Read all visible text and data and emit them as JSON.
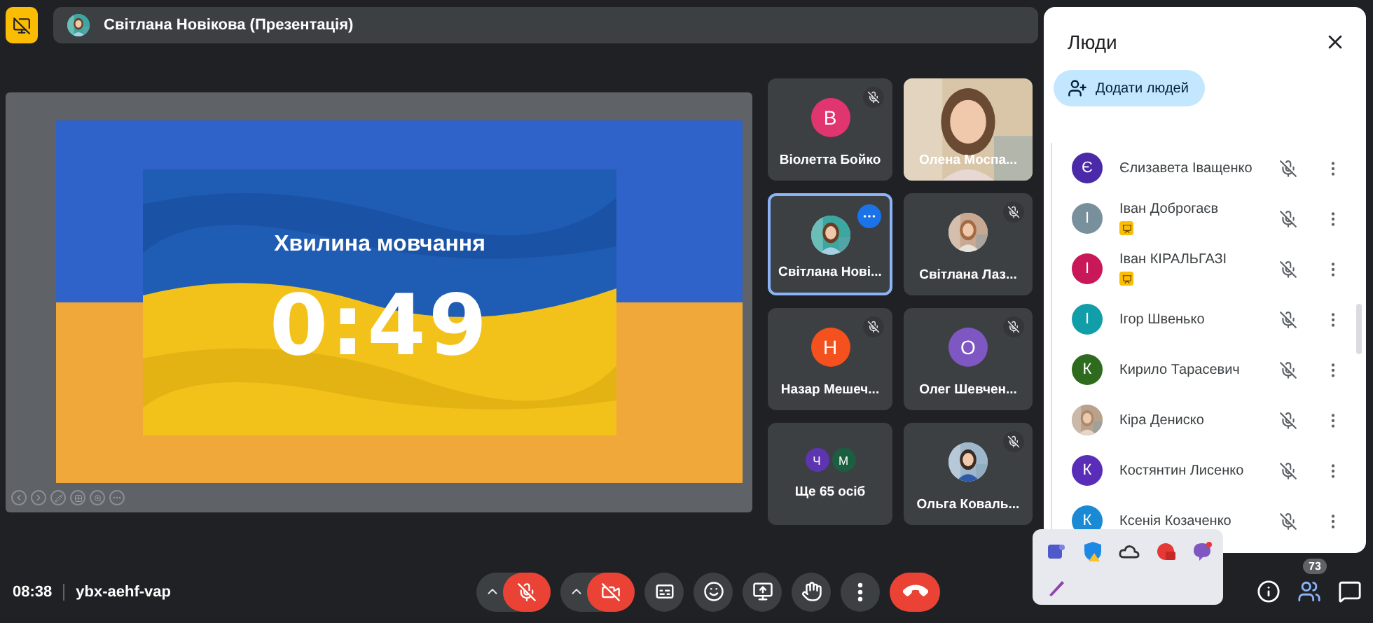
{
  "top_bar": {
    "presenter": "Світлана Новікова (Презентація)"
  },
  "slide": {
    "title": "Хвилина мовчання",
    "timer": "0:49"
  },
  "tiles": [
    {
      "kind": "initial",
      "name": "Віолетта Бойко",
      "initial": "В",
      "color": "#e0356f",
      "muted": true,
      "selected": false
    },
    {
      "kind": "video",
      "name": "Олена Моспа...",
      "muted": false,
      "selected": false
    },
    {
      "name": "Світлана Нові...",
      "muted": false,
      "selected": true
    },
    {
      "name": "Світлана Лаз...",
      "muted": true,
      "selected": false
    },
    {
      "kind": "initial",
      "name": "Назар Мешеч...",
      "initial": "Н",
      "color": "#f4511e",
      "muted": true,
      "selected": false
    },
    {
      "kind": "initial",
      "name": "Олег Шевчен...",
      "initial": "О",
      "color": "#7e57c2",
      "muted": true,
      "selected": false
    },
    {
      "kind": "more",
      "name": "Ще 65 осіб",
      "initials": [
        {
          "letter": "Ч",
          "color": "#5e35b1"
        },
        {
          "letter": "М",
          "color": "#1b5e40"
        }
      ],
      "muted": false,
      "selected": false
    },
    {
      "name": "Ольга Коваль...",
      "muted": true,
      "selected": false
    }
  ],
  "people_panel": {
    "title": "Люди",
    "add_button": "Додати людей",
    "people": [
      {
        "kind": "initial",
        "name": "Єлизавета Іващенко",
        "initial": "Є",
        "color": "#4a2aa8",
        "presenting": false,
        "muted": true
      },
      {
        "kind": "initial",
        "name": "Іван Доброгаєв",
        "initial": "І",
        "color": "#78909c",
        "presenting": true,
        "muted": true
      },
      {
        "kind": "initial",
        "name": "Іван КІРАЛЬГАЗІ",
        "initial": "І",
        "color": "#c8185a",
        "presenting": true,
        "muted": true
      },
      {
        "kind": "initial",
        "name": "Ігор Швенько",
        "initial": "І",
        "color": "#129ea8",
        "presenting": false,
        "muted": true
      },
      {
        "kind": "initial",
        "name": "Кирило Тарасевич",
        "initial": "К",
        "color": "#2e6b1e",
        "presenting": false,
        "muted": true
      },
      {
        "name": "Кіра Дениско",
        "presenting": false,
        "muted": true
      },
      {
        "kind": "initial",
        "name": "Костянтин Лисенко",
        "initial": "К",
        "color": "#5a2db8",
        "presenting": false,
        "muted": true
      },
      {
        "kind": "initial",
        "name": "Ксенія Козаченко",
        "initial": "К",
        "color": "#1a8ad4",
        "presenting": false,
        "muted": true
      }
    ]
  },
  "meeting": {
    "time": "08:38",
    "code": "ybx-aehf-vap"
  },
  "controls": [
    {
      "kind": "mic",
      "on": false
    },
    {
      "kind": "camera",
      "on": false
    },
    {
      "kind": "captions"
    },
    {
      "kind": "emoji"
    },
    {
      "kind": "present"
    },
    {
      "kind": "hand"
    },
    {
      "kind": "more"
    },
    {
      "kind": "end"
    }
  ],
  "participant_count": "73"
}
